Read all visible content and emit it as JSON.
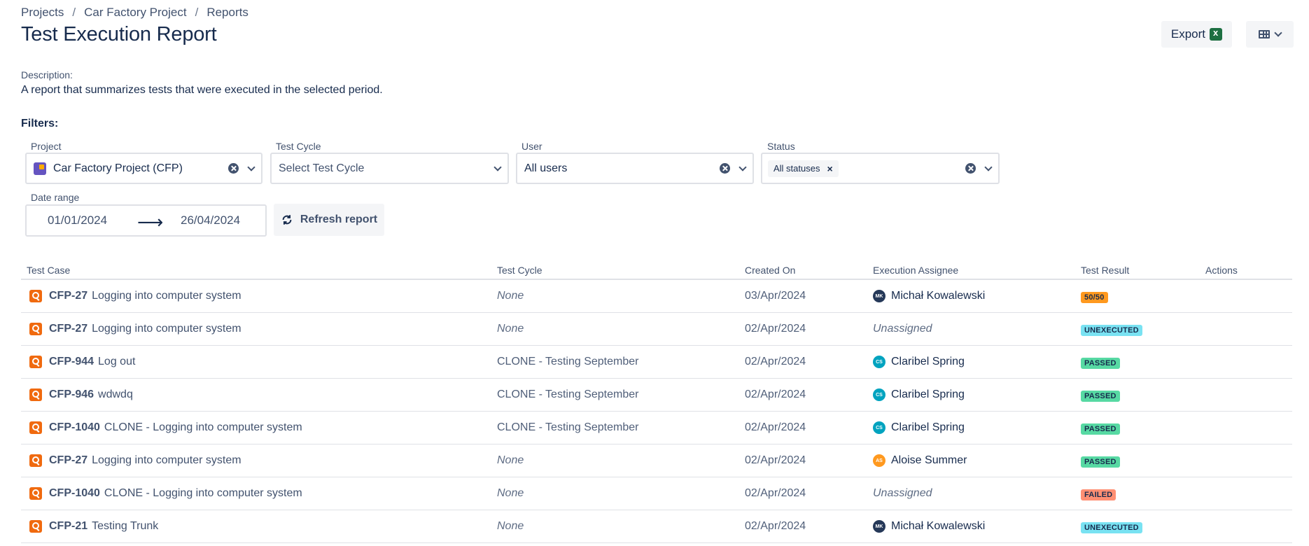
{
  "breadcrumb": [
    "Projects",
    "Car Factory Project",
    "Reports"
  ],
  "page_title": "Test Execution Report",
  "actions": {
    "export_label": "Export"
  },
  "description": {
    "label": "Description:",
    "text": "A report that summarizes tests that were executed in the selected period."
  },
  "filters": {
    "label": "Filters:",
    "project": {
      "label": "Project",
      "value": "Car Factory Project (CFP)"
    },
    "test_cycle": {
      "label": "Test Cycle",
      "placeholder": "Select Test Cycle"
    },
    "user": {
      "label": "User",
      "value": "All users"
    },
    "status": {
      "label": "Status",
      "chip": "All statuses",
      "chip_remove": "×"
    },
    "date_range": {
      "label": "Date range",
      "from": "01/01/2024",
      "arrow": "⟶",
      "to": "26/04/2024"
    },
    "refresh_label": "Refresh report"
  },
  "table": {
    "headers": {
      "test_case": "Test Case",
      "test_cycle": "Test Cycle",
      "created_on": "Created On",
      "assignee": "Execution Assignee",
      "result": "Test Result",
      "actions": "Actions"
    },
    "rows": [
      {
        "key": "CFP-27",
        "name": "Logging into computer system",
        "cycle": "None",
        "created": "03/Apr/2024",
        "assignee": "Michał Kowalewski",
        "initials": "MK",
        "avatar_color": "#253858",
        "result": "50/50",
        "result_color": "#ff991f"
      },
      {
        "key": "CFP-27",
        "name": "Logging into computer system",
        "cycle": "None",
        "created": "02/Apr/2024",
        "assignee": "Unassigned",
        "initials": "",
        "avatar_color": "",
        "result": "UNEXECUTED",
        "result_color": "#79e2f2"
      },
      {
        "key": "CFP-944",
        "name": "Log out",
        "cycle": "CLONE - Testing September",
        "created": "02/Apr/2024",
        "assignee": "Claribel Spring",
        "initials": "CS",
        "avatar_color": "#00a3bf",
        "result": "PASSED",
        "result_color": "#57d9a3"
      },
      {
        "key": "CFP-946",
        "name": "wdwdq",
        "cycle": "CLONE - Testing September",
        "created": "02/Apr/2024",
        "assignee": "Claribel Spring",
        "initials": "CS",
        "avatar_color": "#00a3bf",
        "result": "PASSED",
        "result_color": "#57d9a3"
      },
      {
        "key": "CFP-1040",
        "name": "CLONE - Logging into computer system",
        "cycle": "CLONE - Testing September",
        "created": "02/Apr/2024",
        "assignee": "Claribel Spring",
        "initials": "CS",
        "avatar_color": "#00a3bf",
        "result": "PASSED",
        "result_color": "#57d9a3"
      },
      {
        "key": "CFP-27",
        "name": "Logging into computer system",
        "cycle": "None",
        "created": "02/Apr/2024",
        "assignee": "Aloise Summer",
        "initials": "AS",
        "avatar_color": "#ff991f",
        "result": "PASSED",
        "result_color": "#57d9a3"
      },
      {
        "key": "CFP-1040",
        "name": "CLONE - Logging into computer system",
        "cycle": "None",
        "created": "02/Apr/2024",
        "assignee": "Unassigned",
        "initials": "",
        "avatar_color": "",
        "result": "FAILED",
        "result_color": "#ff8f73"
      },
      {
        "key": "CFP-21",
        "name": "Testing Trunk",
        "cycle": "None",
        "created": "02/Apr/2024",
        "assignee": "Michał Kowalewski",
        "initials": "MK",
        "avatar_color": "#253858",
        "result": "UNEXECUTED",
        "result_color": "#79e2f2"
      }
    ]
  },
  "colors": {
    "text": "#172b4d",
    "subtle_text": "#42526e",
    "border": "#dfe1e6",
    "button_bg": "#f4f5f7",
    "test_case_icon": "#f06a0f"
  },
  "icons": [
    "excel-icon",
    "table-view-icon",
    "chevron-down-icon",
    "clear-icon",
    "project-icon",
    "refresh-icon",
    "test-case-icon",
    "arrow-right-icon"
  ]
}
